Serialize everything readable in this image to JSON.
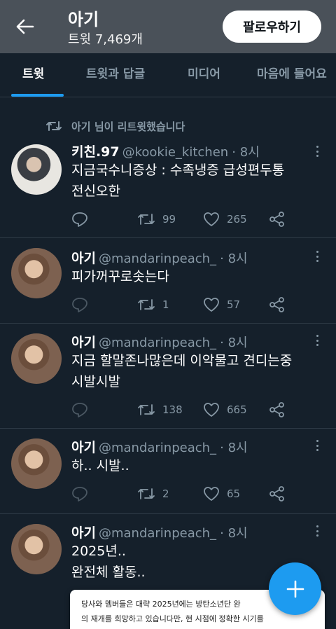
{
  "header": {
    "title": "아기",
    "tweet_count": "트윗 7,469개",
    "follow_label": "팔로우하기"
  },
  "tabs": [
    {
      "label": "트윗",
      "active": true
    },
    {
      "label": "트윗과 답글",
      "active": false
    },
    {
      "label": "미디어",
      "active": false
    },
    {
      "label": "마음에 들어요",
      "active": false
    }
  ],
  "retweet_notice": "아기 님이 리트윗했습니다",
  "tweets": [
    {
      "name": "키친.97",
      "handle": "@kookie_kitchen",
      "time": "· 8시",
      "text_lines": [
        "지금국수니증상 : 수족냉증 급성편두통",
        "전신오한"
      ],
      "retweets": "99",
      "likes": "265",
      "reply_count": ""
    },
    {
      "name": "아기",
      "handle": "@mandarinpeach_",
      "time": "· 8시",
      "text_lines": [
        "피가꺼꾸로솟는다"
      ],
      "retweets": "1",
      "likes": "57",
      "reply_count": ""
    },
    {
      "name": "아기",
      "handle": "@mandarinpeach_",
      "time": "· 8시",
      "text_lines": [
        "지금 할말존나많은데 이악물고 견디는중",
        "시발시발"
      ],
      "retweets": "138",
      "likes": "665",
      "reply_count": ""
    },
    {
      "name": "아기",
      "handle": "@mandarinpeach_",
      "time": "· 8시",
      "text_lines": [
        "하.. 시발.."
      ],
      "retweets": "2",
      "likes": "65",
      "reply_count": ""
    },
    {
      "name": "아기",
      "handle": "@mandarinpeach_",
      "time": "· 8시",
      "text_lines": [
        "2025년..",
        "완전체 활동.."
      ]
    }
  ],
  "notice_card": {
    "line1": "당사와 멤버들은 대략 2025년에는 방탄소년단 완",
    "line2": "의 재개를 희망하고 있습니다만, 현 시점에 정확한 시기를"
  },
  "colors": {
    "background": "#15202b",
    "header": "#4a5159",
    "accent": "#1d9bf0",
    "muted": "#8899a6"
  }
}
